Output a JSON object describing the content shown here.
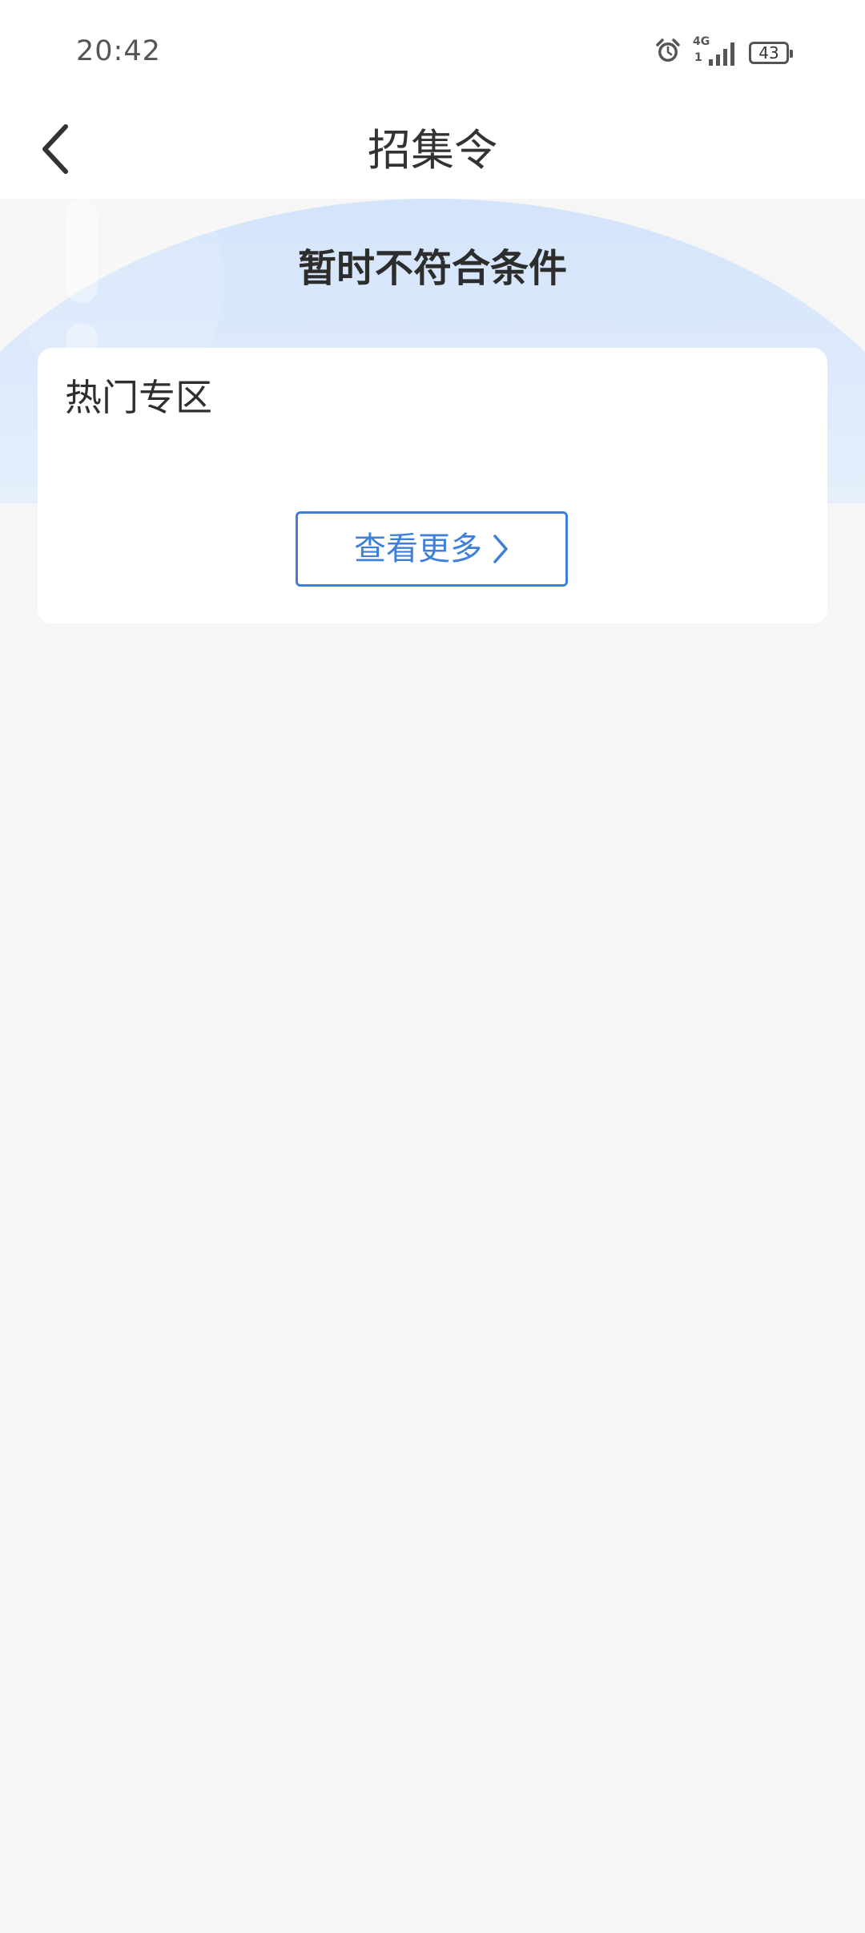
{
  "status_bar": {
    "time": "20:42",
    "network_label": "4G",
    "sim_label": "1",
    "battery": "43",
    "icons": [
      "alarm-icon",
      "signal-icon",
      "battery-icon"
    ]
  },
  "nav": {
    "title": "招集令",
    "back_icon": "chevron-left-icon"
  },
  "hero": {
    "message": "暂时不符合条件"
  },
  "card": {
    "title": "热门专区",
    "more_button_label": "查看更多",
    "more_icon": "chevron-right-icon"
  },
  "colors": {
    "accent": "#3f7fd9",
    "background": "#f6f6f6",
    "hero_gradient_top": "#d3e4fb",
    "card": "#ffffff"
  }
}
